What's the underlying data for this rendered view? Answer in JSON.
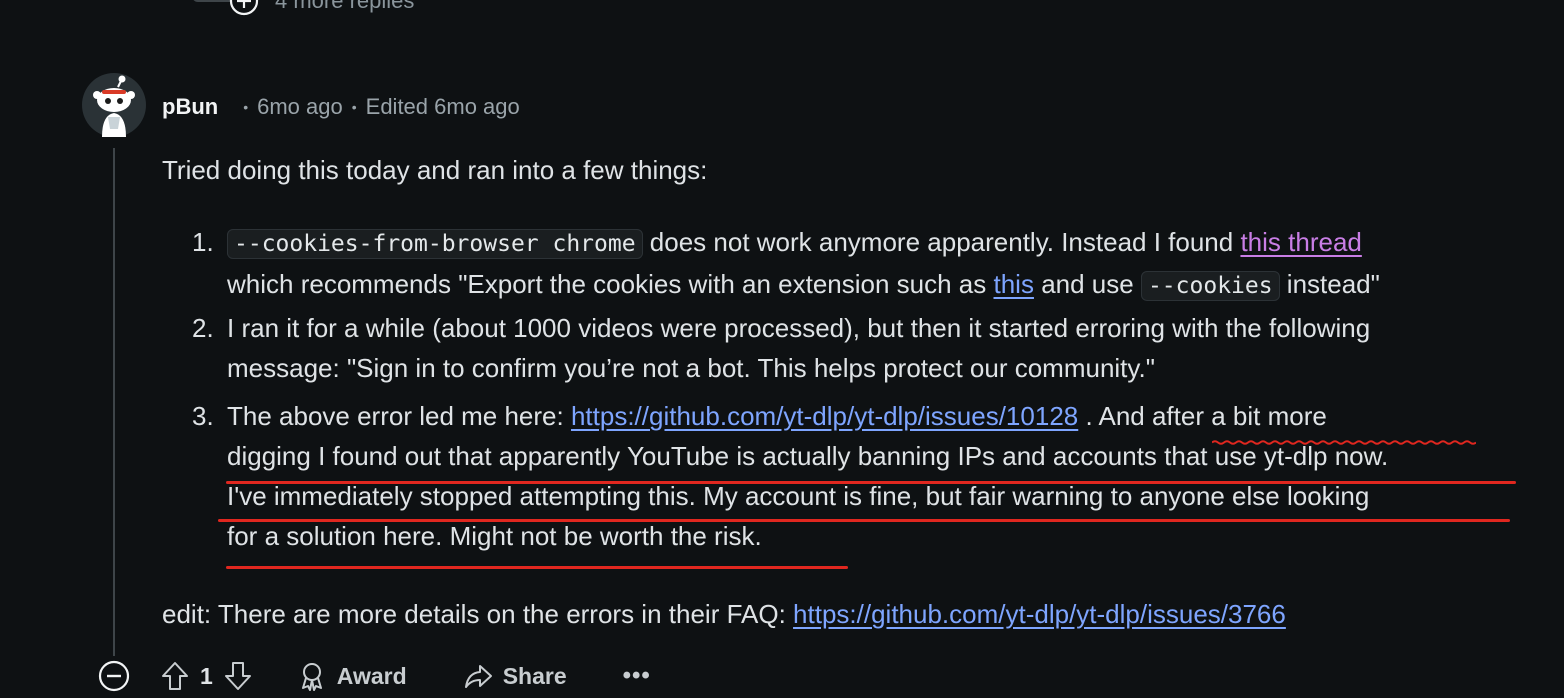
{
  "more_replies": {
    "label": "4 more replies"
  },
  "comment": {
    "author": "pBun",
    "separator": "•",
    "posted": "6mo ago",
    "edited": "Edited 6mo ago",
    "intro": "Tried doing this today and ran into a few things:",
    "items": [
      {
        "number": "1.",
        "code_1": "--cookies-from-browser chrome",
        "text_1": " does not work anymore apparently. Instead I found ",
        "link_1": "this thread",
        "text_2": "which recommends \"Export the cookies with an extension such as ",
        "link_2": "this",
        "text_3": " and use ",
        "code_2": "--cookies",
        "text_4": " instead\""
      },
      {
        "number": "2.",
        "line_1": "I ran it for a while (about 1000 videos were processed), but then it started erroring with the following",
        "line_2": "message: \"Sign in to confirm you’re not a bot. This helps protect our community.\""
      },
      {
        "number": "3.",
        "text_1": "The above error led me here: ",
        "link": "https://github.com/yt-dlp/yt-dlp/issues/10128",
        "text_2": " . And after a bit more",
        "line_2": "digging I found out that apparently YouTube is actually banning IPs and accounts that use yt-dlp now.",
        "line_3": "I've immediately stopped attempting this. My account is fine, but fair warning to anyone else looking",
        "line_4": "for a solution here. Might not be worth the risk."
      }
    ],
    "edit_text": "edit: There are more details on the errors in their FAQ: ",
    "edit_link": "https://github.com/yt-dlp/yt-dlp/issues/3766"
  },
  "actions": {
    "vote_count": "1",
    "award_label": "Award",
    "share_label": "Share",
    "more_label": "•••"
  },
  "colors": {
    "background": "#0e1113",
    "text": "#dfe3e6",
    "link": "#7ea5ff",
    "visited_link": "#c97ee6",
    "annotation": "#e0271f"
  }
}
